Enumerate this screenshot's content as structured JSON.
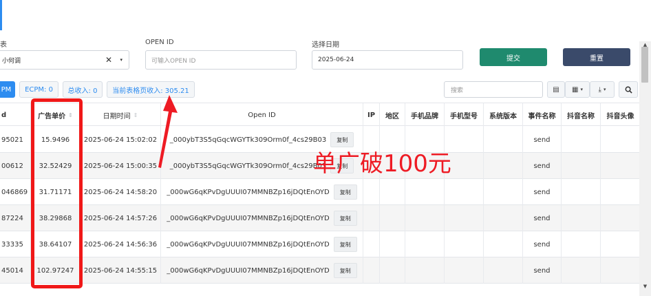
{
  "filters": {
    "label_left": "表",
    "dropdown_value": "小何调",
    "openid_label": "OPEN ID",
    "openid_placeholder": "可输入OPEN ID",
    "date_label": "选择日期",
    "date_value": "2025-06-24",
    "submit_label": "提交",
    "reset_label": "重置",
    "submit_color": "#1f8a6e",
    "reset_color": "#3a4a6a"
  },
  "stats": {
    "pm_label": "PM",
    "ecpm": "ECPM: 0",
    "total_income": "总收入: 0",
    "page_income": "当前表格页收入: 305.21"
  },
  "toolbar": {
    "search_placeholder": "搜索"
  },
  "table": {
    "headers": {
      "id": "d",
      "price": "广告单价",
      "datetime": "日期时间",
      "openid": "Open ID",
      "ip": "IP",
      "region": "地区",
      "brand": "手机品牌",
      "model": "手机型号",
      "os": "系统版本",
      "event": "事件名称",
      "dy_name": "抖音名称",
      "dy_avatar": "抖音头像"
    },
    "copy_label": "复制",
    "rows": [
      {
        "id": "95021",
        "price": "15.9496",
        "datetime": "2025-06-24 15:02:02",
        "openid": "_000ybT3S5qGqcWGYTk309Orm0f_4cs29B03",
        "event": "send"
      },
      {
        "id": "00612",
        "price": "32.52429",
        "datetime": "2025-06-24 15:00:35",
        "openid": "_000ybT3S5qGqcWGYTk309Orm0f_4cs29B03",
        "event": "send"
      },
      {
        "id": "046869",
        "price": "31.71171",
        "datetime": "2025-06-24 14:58:20",
        "openid": "_000wG6qKPvDgUUUI07MMNBZp16jDQtEnOYD",
        "event": "send"
      },
      {
        "id": "87224",
        "price": "38.29868",
        "datetime": "2025-06-24 14:57:26",
        "openid": "_000wG6qKPvDgUUUI07MMNBZp16jDQtEnOYD",
        "event": "send"
      },
      {
        "id": "33335",
        "price": "38.64107",
        "datetime": "2025-06-24 14:56:36",
        "openid": "_000wG6qKPvDgUUUI07MMNBZp16jDQtEnOYD",
        "event": "send"
      },
      {
        "id": "45014",
        "price": "102.97247",
        "datetime": "2025-06-24 14:55:15",
        "openid": "_000wG6qKPvDgUUUI07MMNBZp16jDQtEnOYD",
        "event": "send"
      }
    ]
  },
  "annotation": {
    "text": "单广破100元",
    "color": "#ee1b24"
  }
}
